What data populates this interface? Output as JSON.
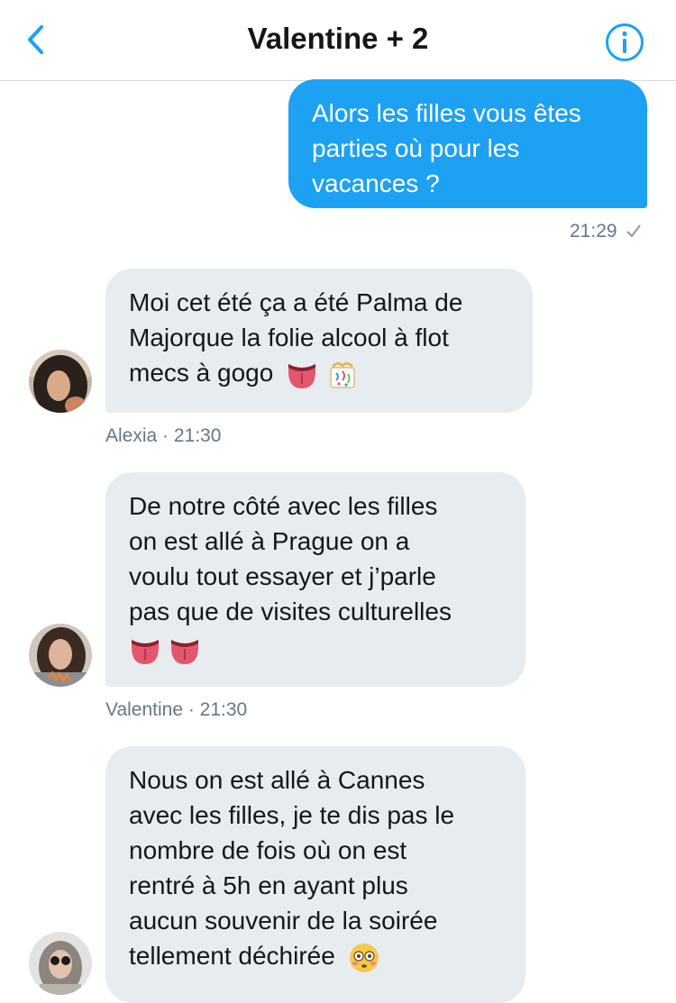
{
  "header": {
    "title": "Valentine + 2",
    "back_icon": "chevron-left-icon",
    "info_icon": "info-icon",
    "accent_color": "#1da1f2"
  },
  "messages": [
    {
      "direction": "outgoing",
      "lines": [
        "Alors les filles vous êtes",
        "parties où pour les",
        "vacances ?"
      ],
      "time": "21:29",
      "status_icon": "check-icon"
    },
    {
      "direction": "incoming",
      "sender": "Alexia",
      "lines": [
        "Moi cet été ça a été Palma de",
        "Majorque la folie alcool à flot",
        "mecs à gogo"
      ],
      "emojis": [
        "tongue-emoji",
        "party-popper-emoji"
      ],
      "meta": "Alexia · 21:30"
    },
    {
      "direction": "incoming",
      "sender": "Valentine",
      "lines": [
        "De notre côté avec les filles",
        "on est allé à Prague on a",
        "voulu tout essayer et j’parle",
        "pas que de visites culturelles"
      ],
      "emojis": [
        "tongue-emoji",
        "tongue-emoji"
      ],
      "meta": "Valentine · 21:30"
    },
    {
      "direction": "incoming",
      "lines": [
        "Nous on est allé à Cannes",
        "avec les filles, je te dis pas le",
        "nombre de fois où on est",
        "rentré à 5h en ayant plus",
        "aucun souvenir de la soirée",
        "tellement déchirée"
      ],
      "emojis": [
        "flushed-face-emoji"
      ]
    }
  ]
}
